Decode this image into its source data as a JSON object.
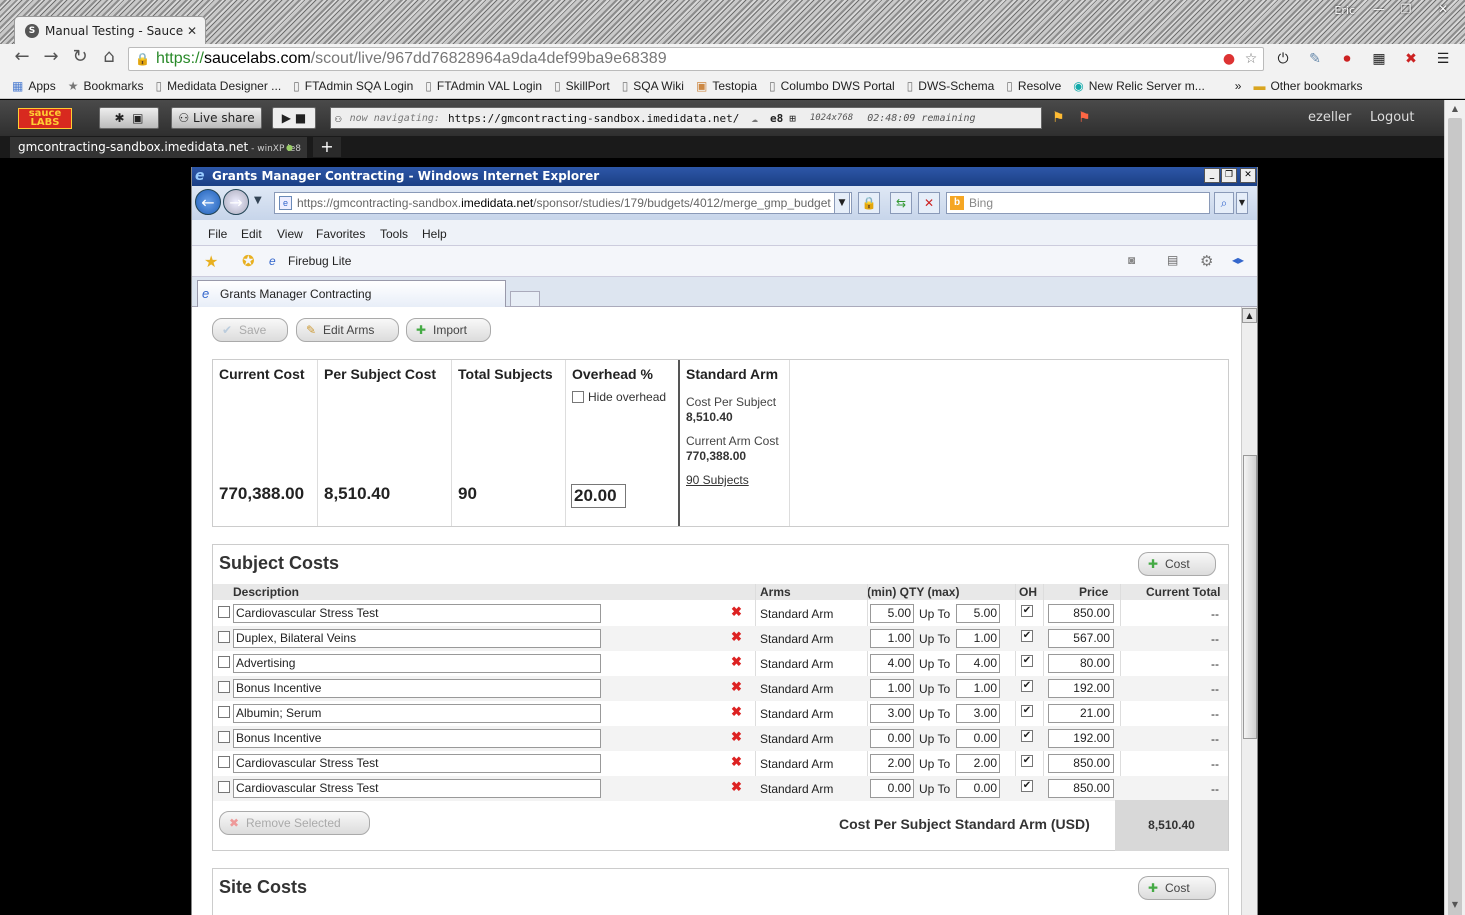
{
  "chrome": {
    "tab_title": "Manual Testing - Sauce La",
    "window_user": "Eric",
    "url_https": "https://",
    "url_host": "saucelabs.com",
    "url_path": "/scout/live/967dd76828964a9da4def99ba9e68389"
  },
  "bookmarks": [
    {
      "label": "Apps",
      "icon": "apps-grid-icon"
    },
    {
      "label": "Bookmarks",
      "icon": "star-icon"
    },
    {
      "label": "Medidata Designer ...",
      "icon": "page-icon"
    },
    {
      "label": "FTAdmin SQA Login",
      "icon": "page-icon"
    },
    {
      "label": "FTAdmin VAL Login",
      "icon": "page-icon"
    },
    {
      "label": "SkillPort",
      "icon": "page-icon"
    },
    {
      "label": "SQA Wiki",
      "icon": "page-icon"
    },
    {
      "label": "Testopia",
      "icon": "page-icon"
    },
    {
      "label": "Columbo DWS Portal",
      "icon": "page-icon"
    },
    {
      "label": "DWS-Schema",
      "icon": "page-icon"
    },
    {
      "label": "Resolve",
      "icon": "page-icon"
    },
    {
      "label": "New Relic Server m...",
      "icon": "page-icon"
    },
    {
      "label": "»",
      "icon": ""
    },
    {
      "label": "Other bookmarks",
      "icon": "folder-icon"
    }
  ],
  "sauce": {
    "logo_top": "sauce",
    "logo_bottom": "LABS",
    "live_share": "Live share",
    "nav_label": "now navigating:",
    "nav_url": "https://gmcontracting-sandbox.imedidata.net/",
    "browser_badge": "e8",
    "resolution": "1024x768",
    "remaining": "02:48:09 remaining",
    "user": "ezeller",
    "logout": "Logout",
    "session_tab": "gmcontracting-sandbox.imedidata.net",
    "session_tab_sub": " - winXP ie8",
    "add_tab": "+"
  },
  "ie": {
    "title": "Grants Manager Contracting - Windows Internet Explorer",
    "address_prefix": "https://",
    "address_host_pre": "gmcontracting-sandbox.",
    "address_host": "imedidata.net",
    "address_path": "/sponsor/studies/179/budgets/4012/merge_gmp_budget",
    "search_placeholder": "Bing",
    "menu": [
      "File",
      "Edit",
      "View",
      "Favorites",
      "Tools",
      "Help"
    ],
    "fav_item": "Firebug Lite",
    "tab_title": "Grants Manager Contracting"
  },
  "toolbar": {
    "save": "Save",
    "edit_arms": "Edit Arms",
    "import": "Import"
  },
  "summary": {
    "current_cost_label": "Current Cost",
    "current_cost": "770,388.00",
    "per_subject_label": "Per Subject Cost",
    "per_subject": "8,510.40",
    "total_subjects_label": "Total Subjects",
    "total_subjects": "90",
    "overhead_label": "Overhead %",
    "hide_overhead": "Hide overhead",
    "overhead_value": "20.00",
    "arm_title": "Standard Arm",
    "arm_cps_label": "Cost Per Subject",
    "arm_cps": "8,510.40",
    "arm_cost_label": "Current Arm Cost",
    "arm_cost": "770,388.00",
    "arm_subjects_link": "90 Subjects"
  },
  "subject_costs": {
    "title": "Subject Costs",
    "add_cost": "Cost",
    "columns": {
      "description": "Description",
      "arms": "Arms",
      "qty": "(min) QTY (max)",
      "oh": "OH",
      "price": "Price",
      "total": "Current Total"
    },
    "up_to": "Up To",
    "rows": [
      {
        "description": "Cardiovascular Stress Test",
        "arm": "Standard Arm",
        "min": "5.00",
        "max": "5.00",
        "price": "850.00",
        "total": "--"
      },
      {
        "description": "Duplex, Bilateral Veins",
        "arm": "Standard Arm",
        "min": "1.00",
        "max": "1.00",
        "price": "567.00",
        "total": "--"
      },
      {
        "description": "Advertising",
        "arm": "Standard Arm",
        "min": "4.00",
        "max": "4.00",
        "price": "80.00",
        "total": "--"
      },
      {
        "description": "Bonus Incentive",
        "arm": "Standard Arm",
        "min": "1.00",
        "max": "1.00",
        "price": "192.00",
        "total": "--"
      },
      {
        "description": "Albumin; Serum",
        "arm": "Standard Arm",
        "min": "3.00",
        "max": "3.00",
        "price": "21.00",
        "total": "--"
      },
      {
        "description": "Bonus Incentive",
        "arm": "Standard Arm",
        "min": "0.00",
        "max": "0.00",
        "price": "192.00",
        "total": "--"
      },
      {
        "description": "Cardiovascular Stress Test",
        "arm": "Standard Arm",
        "min": "2.00",
        "max": "2.00",
        "price": "850.00",
        "total": "--"
      },
      {
        "description": "Cardiovascular Stress Test",
        "arm": "Standard Arm",
        "min": "0.00",
        "max": "0.00",
        "price": "850.00",
        "total": "--"
      }
    ],
    "remove_selected": "Remove Selected",
    "footer_label": "Cost Per Subject Standard Arm (USD)",
    "footer_value": "8,510.40"
  },
  "site_costs": {
    "title": "Site Costs",
    "add_cost": "Cost"
  }
}
